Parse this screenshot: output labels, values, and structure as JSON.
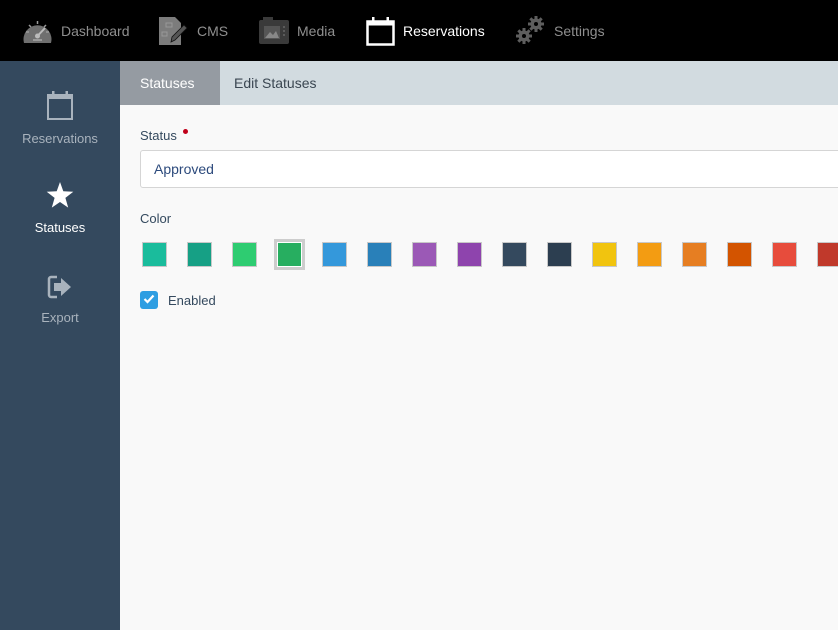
{
  "topnav": {
    "items": [
      {
        "label": "Dashboard",
        "icon": "speedometer-icon",
        "active": false
      },
      {
        "label": "CMS",
        "icon": "cms-document-icon",
        "active": false
      },
      {
        "label": "Media",
        "icon": "media-image-icon",
        "active": false
      },
      {
        "label": "Reservations",
        "icon": "calendar-icon",
        "active": true
      },
      {
        "label": "Settings",
        "icon": "gears-icon",
        "active": false
      }
    ]
  },
  "sidebar": {
    "items": [
      {
        "label": "Reservations",
        "icon": "calendar-icon",
        "active": false
      },
      {
        "label": "Statuses",
        "icon": "star-icon",
        "active": true
      },
      {
        "label": "Export",
        "icon": "export-icon",
        "active": false
      }
    ]
  },
  "breadcrumb": {
    "items": [
      "Statuses",
      "Edit Statuses"
    ]
  },
  "form": {
    "status_label": "Status",
    "status_required": true,
    "status_value": "Approved",
    "color_label": "Color",
    "colors": [
      "#1abc9c",
      "#16a085",
      "#2ecc71",
      "#27ae60",
      "#3498db",
      "#2980b9",
      "#9b59b6",
      "#8e44ad",
      "#34495e",
      "#2c3e50",
      "#f1c40f",
      "#f39c12",
      "#e67e22",
      "#d35400",
      "#e74c3c",
      "#c0392b"
    ],
    "selected_color": "#27ae60",
    "enabled_label": "Enabled",
    "enabled": true
  }
}
